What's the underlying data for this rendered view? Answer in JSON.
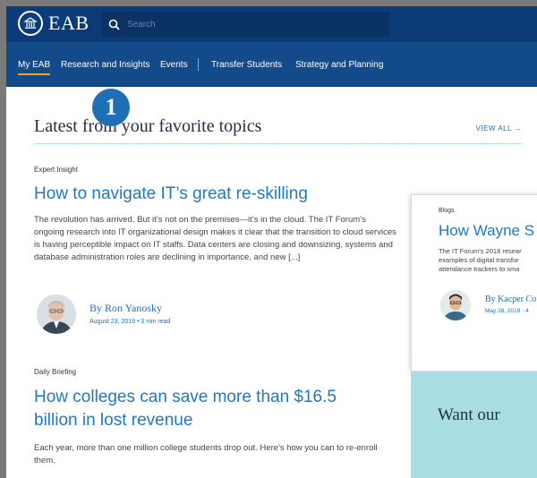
{
  "header": {
    "logo_text": "EAB",
    "search_placeholder": "Search"
  },
  "nav": {
    "items": [
      "My EAB",
      "Research and Insights",
      "Events",
      "Transfer Students",
      "Strategy and Planning"
    ],
    "separator": "|"
  },
  "section": {
    "title": "Latest from your favorite topics",
    "view_all": "VIEW ALL →",
    "badge": "1"
  },
  "articles": [
    {
      "category": "Expert Insight",
      "title": "How to navigate IT’s great re-skilling",
      "excerpt": "The revolution has arrived. But it’s not on the premises—it’s in the cloud. The IT Forum’s ongoing research into IT organizational design makes it clear that the transition to cloud services is having perceptible impact on IT staffs. Data centers are closing and downsizing, systems and database administration roles are declining in importance, and new [...]",
      "author": "By Ron Yanosky",
      "date": "August 23, 2019",
      "read_time": "3 min read"
    },
    {
      "category": "Daily Briefing",
      "title": "How colleges can save more than $16.5 billion in lost revenue",
      "excerpt": "Each year, more than one million college students drop out. Here's how you can to re-enroll them."
    }
  ],
  "side_card": {
    "category": "Blogs",
    "title": "How Wayne S",
    "excerpt": "The IT Forum's 2018 resear examples of digital transfor attendance trackers to sma",
    "author": "By Kacper Co",
    "date": "May 28, 2019 · 4"
  },
  "promo": {
    "text": "Want our"
  }
}
